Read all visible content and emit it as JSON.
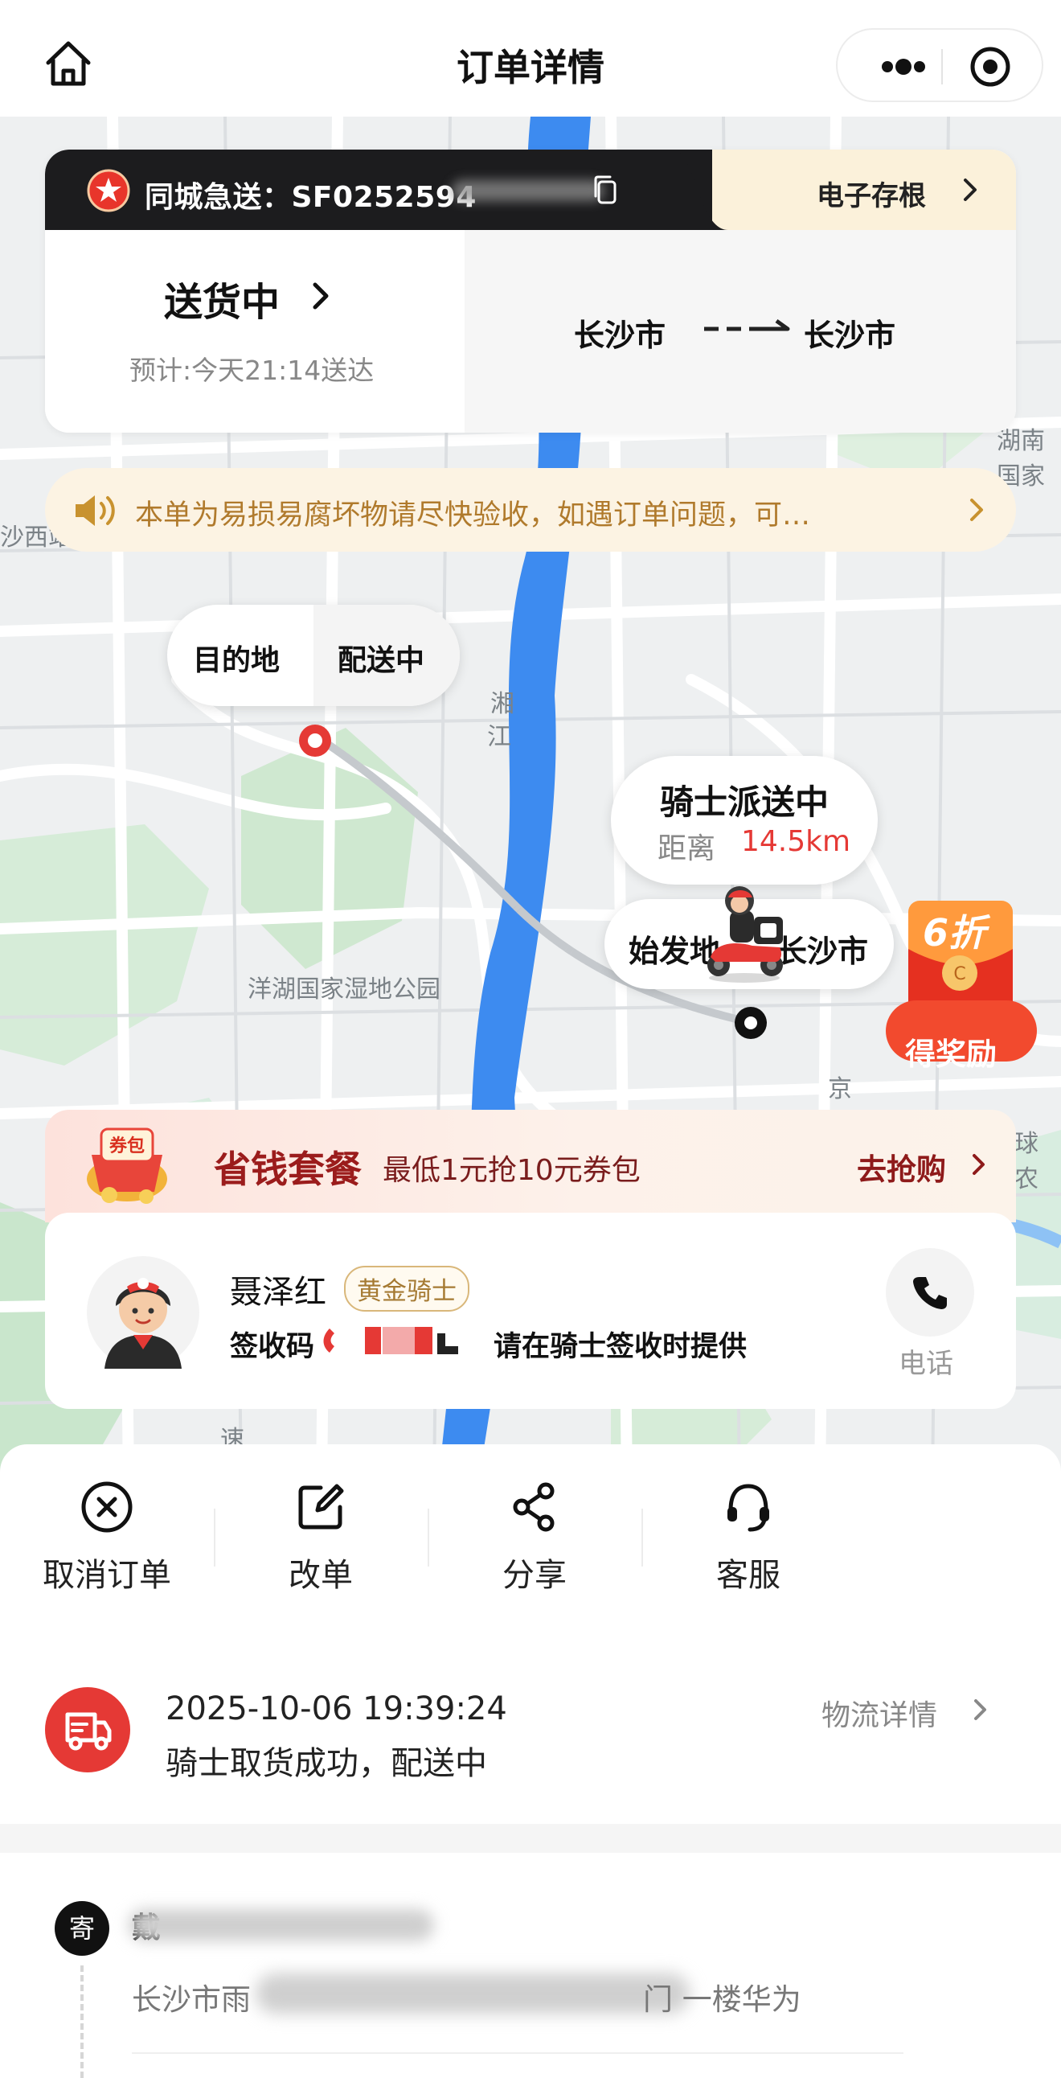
{
  "header": {
    "title": "订单详情"
  },
  "status_card": {
    "service_label": "同城急送：SF0252594",
    "stub_link": "电子存根",
    "status": "送货中",
    "eta": "预计:今天21:14送达",
    "from_city": "长沙市",
    "to_city": "长沙市"
  },
  "notice": {
    "text": "本单为易损易腐坏物请尽快验收，如遇订单问题，可…"
  },
  "map": {
    "labels": [
      "湘",
      "江",
      "洋湖国家湿地公园",
      "湖南",
      "国家",
      "沙西站",
      "球农",
      "京",
      "速"
    ],
    "destination_bubble": {
      "left": "目的地",
      "right": "配送中"
    },
    "rider_bubble": {
      "title": "骑士派送中",
      "distance_label": "距离",
      "distance_value": "14.5km"
    },
    "origin_bubble": {
      "left": "始发地",
      "right": "长沙市"
    },
    "promo": {
      "discount": "6折",
      "label": "得奖励"
    }
  },
  "saver": {
    "coupon_text": "券包",
    "title": "省钱套餐",
    "subtitle": "最低1元抢10元券包",
    "cta": "去抢购"
  },
  "rider": {
    "name": "聂泽红",
    "tag": "黄金骑士",
    "sign_label": "签收码",
    "sign_hint": "请在骑士签收时提供",
    "phone_label": "电话"
  },
  "actions": [
    {
      "label": "取消订单",
      "icon": "cancel-circle-icon"
    },
    {
      "label": "改单",
      "icon": "edit-icon"
    },
    {
      "label": "分享",
      "icon": "share-icon"
    },
    {
      "label": "客服",
      "icon": "headset-icon"
    }
  ],
  "tracking": {
    "time": "2025-10-06 19:39:24",
    "message": "骑士取货成功，配送中",
    "link": "物流详情"
  },
  "sender": {
    "badge": "寄",
    "name": "戴",
    "address_head": "长沙市雨",
    "address_tail": "门 一楼华为"
  },
  "colors": {
    "accent_red": "#e53935",
    "dark_header": "#1c1c1e",
    "gold": "#a57a33",
    "notice_text": "#b07a2c",
    "river": "#3d8bf0"
  }
}
